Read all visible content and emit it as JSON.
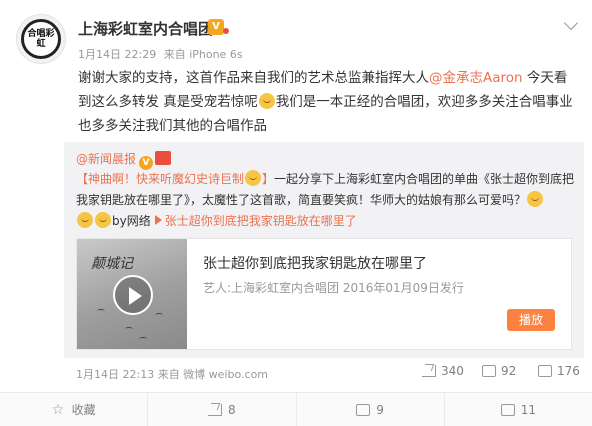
{
  "post": {
    "avatar_text": "合唱彩虹",
    "username": "上海彩虹室内合唱团",
    "meta": {
      "date": "1月14日 22:29",
      "source": "来自 iPhone 6s"
    },
    "text": {
      "line1_a": "谢谢大家的支持，这首作品来自我们的艺术总监兼指挥大人",
      "mention": "@金承志Aaron",
      "line1_b": " 今天看到这么多转发 真是受宠若惊呢",
      "line1_c": "我们是一本正经的合唱团，欢迎多多关注合唱事业 也多多关注我们其他的合唱作品"
    }
  },
  "repost": {
    "author": "@新闻晨报",
    "text_hl": "【神曲啊！快来听魔幻史诗巨制",
    "text_hl_end": "】",
    "text_a": "一起分享下上海彩虹室内合唱团的单曲《张士超你到底把我家钥匙放在哪里了》，太魔性了这首歌，简直要笑疯！华师大的姑娘有那么可爱吗？",
    "text_by": "by网络",
    "link": "张士超你到底把我家钥匙放在哪里了",
    "card": {
      "thumb_text": "颠城记",
      "title": "张士超你到底把我家钥匙放在哪里了",
      "artist": "艺人:上海彩虹室内合唱团 2016年01月09日发行",
      "play_label": "播放"
    },
    "footer": "1月14日 22:13 来自 微博 weibo.com",
    "stats": {
      "shares": "340",
      "comments": "92",
      "likes": "176"
    }
  },
  "toolbar": {
    "favorite": "收藏",
    "share": "8",
    "comment": "9",
    "like": "11"
  }
}
